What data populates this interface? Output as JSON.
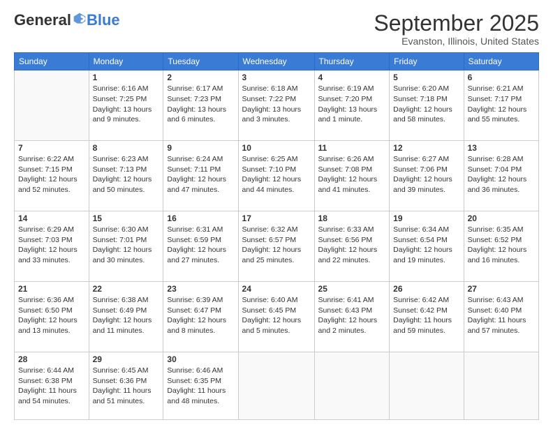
{
  "logo": {
    "general": "General",
    "blue": "Blue"
  },
  "header": {
    "month": "September 2025",
    "location": "Evanston, Illinois, United States"
  },
  "days": [
    "Sunday",
    "Monday",
    "Tuesday",
    "Wednesday",
    "Thursday",
    "Friday",
    "Saturday"
  ],
  "weeks": [
    [
      {
        "day": "",
        "sunrise": "",
        "sunset": "",
        "daylight": ""
      },
      {
        "day": "1",
        "sunrise": "Sunrise: 6:16 AM",
        "sunset": "Sunset: 7:25 PM",
        "daylight": "Daylight: 13 hours and 9 minutes."
      },
      {
        "day": "2",
        "sunrise": "Sunrise: 6:17 AM",
        "sunset": "Sunset: 7:23 PM",
        "daylight": "Daylight: 13 hours and 6 minutes."
      },
      {
        "day": "3",
        "sunrise": "Sunrise: 6:18 AM",
        "sunset": "Sunset: 7:22 PM",
        "daylight": "Daylight: 13 hours and 3 minutes."
      },
      {
        "day": "4",
        "sunrise": "Sunrise: 6:19 AM",
        "sunset": "Sunset: 7:20 PM",
        "daylight": "Daylight: 13 hours and 1 minute."
      },
      {
        "day": "5",
        "sunrise": "Sunrise: 6:20 AM",
        "sunset": "Sunset: 7:18 PM",
        "daylight": "Daylight: 12 hours and 58 minutes."
      },
      {
        "day": "6",
        "sunrise": "Sunrise: 6:21 AM",
        "sunset": "Sunset: 7:17 PM",
        "daylight": "Daylight: 12 hours and 55 minutes."
      }
    ],
    [
      {
        "day": "7",
        "sunrise": "Sunrise: 6:22 AM",
        "sunset": "Sunset: 7:15 PM",
        "daylight": "Daylight: 12 hours and 52 minutes."
      },
      {
        "day": "8",
        "sunrise": "Sunrise: 6:23 AM",
        "sunset": "Sunset: 7:13 PM",
        "daylight": "Daylight: 12 hours and 50 minutes."
      },
      {
        "day": "9",
        "sunrise": "Sunrise: 6:24 AM",
        "sunset": "Sunset: 7:11 PM",
        "daylight": "Daylight: 12 hours and 47 minutes."
      },
      {
        "day": "10",
        "sunrise": "Sunrise: 6:25 AM",
        "sunset": "Sunset: 7:10 PM",
        "daylight": "Daylight: 12 hours and 44 minutes."
      },
      {
        "day": "11",
        "sunrise": "Sunrise: 6:26 AM",
        "sunset": "Sunset: 7:08 PM",
        "daylight": "Daylight: 12 hours and 41 minutes."
      },
      {
        "day": "12",
        "sunrise": "Sunrise: 6:27 AM",
        "sunset": "Sunset: 7:06 PM",
        "daylight": "Daylight: 12 hours and 39 minutes."
      },
      {
        "day": "13",
        "sunrise": "Sunrise: 6:28 AM",
        "sunset": "Sunset: 7:04 PM",
        "daylight": "Daylight: 12 hours and 36 minutes."
      }
    ],
    [
      {
        "day": "14",
        "sunrise": "Sunrise: 6:29 AM",
        "sunset": "Sunset: 7:03 PM",
        "daylight": "Daylight: 12 hours and 33 minutes."
      },
      {
        "day": "15",
        "sunrise": "Sunrise: 6:30 AM",
        "sunset": "Sunset: 7:01 PM",
        "daylight": "Daylight: 12 hours and 30 minutes."
      },
      {
        "day": "16",
        "sunrise": "Sunrise: 6:31 AM",
        "sunset": "Sunset: 6:59 PM",
        "daylight": "Daylight: 12 hours and 27 minutes."
      },
      {
        "day": "17",
        "sunrise": "Sunrise: 6:32 AM",
        "sunset": "Sunset: 6:57 PM",
        "daylight": "Daylight: 12 hours and 25 minutes."
      },
      {
        "day": "18",
        "sunrise": "Sunrise: 6:33 AM",
        "sunset": "Sunset: 6:56 PM",
        "daylight": "Daylight: 12 hours and 22 minutes."
      },
      {
        "day": "19",
        "sunrise": "Sunrise: 6:34 AM",
        "sunset": "Sunset: 6:54 PM",
        "daylight": "Daylight: 12 hours and 19 minutes."
      },
      {
        "day": "20",
        "sunrise": "Sunrise: 6:35 AM",
        "sunset": "Sunset: 6:52 PM",
        "daylight": "Daylight: 12 hours and 16 minutes."
      }
    ],
    [
      {
        "day": "21",
        "sunrise": "Sunrise: 6:36 AM",
        "sunset": "Sunset: 6:50 PM",
        "daylight": "Daylight: 12 hours and 13 minutes."
      },
      {
        "day": "22",
        "sunrise": "Sunrise: 6:38 AM",
        "sunset": "Sunset: 6:49 PM",
        "daylight": "Daylight: 12 hours and 11 minutes."
      },
      {
        "day": "23",
        "sunrise": "Sunrise: 6:39 AM",
        "sunset": "Sunset: 6:47 PM",
        "daylight": "Daylight: 12 hours and 8 minutes."
      },
      {
        "day": "24",
        "sunrise": "Sunrise: 6:40 AM",
        "sunset": "Sunset: 6:45 PM",
        "daylight": "Daylight: 12 hours and 5 minutes."
      },
      {
        "day": "25",
        "sunrise": "Sunrise: 6:41 AM",
        "sunset": "Sunset: 6:43 PM",
        "daylight": "Daylight: 12 hours and 2 minutes."
      },
      {
        "day": "26",
        "sunrise": "Sunrise: 6:42 AM",
        "sunset": "Sunset: 6:42 PM",
        "daylight": "Daylight: 11 hours and 59 minutes."
      },
      {
        "day": "27",
        "sunrise": "Sunrise: 6:43 AM",
        "sunset": "Sunset: 6:40 PM",
        "daylight": "Daylight: 11 hours and 57 minutes."
      }
    ],
    [
      {
        "day": "28",
        "sunrise": "Sunrise: 6:44 AM",
        "sunset": "Sunset: 6:38 PM",
        "daylight": "Daylight: 11 hours and 54 minutes."
      },
      {
        "day": "29",
        "sunrise": "Sunrise: 6:45 AM",
        "sunset": "Sunset: 6:36 PM",
        "daylight": "Daylight: 11 hours and 51 minutes."
      },
      {
        "day": "30",
        "sunrise": "Sunrise: 6:46 AM",
        "sunset": "Sunset: 6:35 PM",
        "daylight": "Daylight: 11 hours and 48 minutes."
      },
      {
        "day": "",
        "sunrise": "",
        "sunset": "",
        "daylight": ""
      },
      {
        "day": "",
        "sunrise": "",
        "sunset": "",
        "daylight": ""
      },
      {
        "day": "",
        "sunrise": "",
        "sunset": "",
        "daylight": ""
      },
      {
        "day": "",
        "sunrise": "",
        "sunset": "",
        "daylight": ""
      }
    ]
  ]
}
